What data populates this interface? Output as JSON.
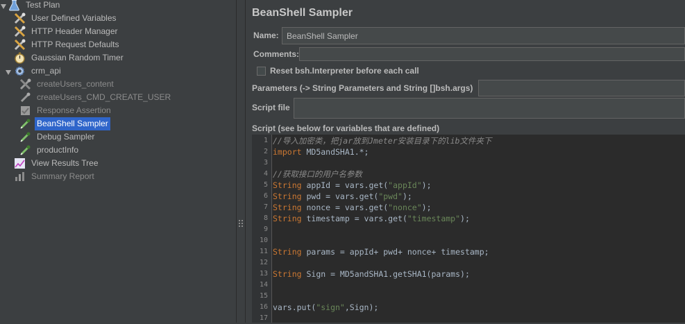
{
  "tree": {
    "items": [
      {
        "label": "Test Plan",
        "icon": "flask-icon"
      },
      {
        "label": "User Defined Variables",
        "icon": "wrench-screwdriver-icon"
      },
      {
        "label": "HTTP Header Manager",
        "icon": "wrench-screwdriver-icon"
      },
      {
        "label": "HTTP Request Defaults",
        "icon": "wrench-screwdriver-icon"
      },
      {
        "label": "Gaussian Random Timer",
        "icon": "stopwatch-icon"
      },
      {
        "label": "crm_api",
        "icon": "gear-icon"
      },
      {
        "label": "createUsers_content",
        "icon": "wrench-screwdriver-icon"
      },
      {
        "label": "createUsers_CMD_CREATE_USER",
        "icon": "pipette-icon"
      },
      {
        "label": "Response Assertion",
        "icon": "assertion-icon"
      },
      {
        "label": "BeanShell Sampler",
        "icon": "pipette-icon"
      },
      {
        "label": "Debug Sampler",
        "icon": "pipette-icon"
      },
      {
        "label": "productInfo",
        "icon": "pipette-icon"
      },
      {
        "label": "View Results Tree",
        "icon": "chart-icon"
      },
      {
        "label": "Summary Report",
        "icon": "bar-chart-icon"
      }
    ]
  },
  "panel": {
    "title": "BeanShell Sampler",
    "name_label": "Name:",
    "name_value": "BeanShell Sampler",
    "comments_label": "Comments:",
    "reset_label": "Reset bsh.Interpreter before each call",
    "params_label": "Parameters (-> String Parameters and String []bsh.args)",
    "script_file_label": "Script file",
    "script_label": "Script (see below for variables that are defined)"
  },
  "editor": {
    "line_numbers": [
      "1",
      "2",
      "3",
      "4",
      "5",
      "6",
      "7",
      "8",
      "9",
      "10",
      "11",
      "12",
      "13",
      "14",
      "15",
      "16",
      "17"
    ],
    "lines": [
      [
        {
          "t": "//导入加密类，把jar放到Jmeter安装目录下的lib文件夹下",
          "c": "cm"
        }
      ],
      [
        {
          "t": "import",
          "c": "kw"
        },
        {
          "t": " MD5andSHA1.*;",
          "c": ""
        }
      ],
      [],
      [
        {
          "t": "//获取接口的用户名参数",
          "c": "cm"
        }
      ],
      [
        {
          "t": "String",
          "c": "kw"
        },
        {
          "t": " appId = vars.get(",
          "c": ""
        },
        {
          "t": "\"appId\"",
          "c": "st"
        },
        {
          "t": ");",
          "c": ""
        }
      ],
      [
        {
          "t": "String",
          "c": "kw"
        },
        {
          "t": " pwd = vars.get(",
          "c": ""
        },
        {
          "t": "\"pwd\"",
          "c": "st"
        },
        {
          "t": ");",
          "c": ""
        }
      ],
      [
        {
          "t": "String",
          "c": "kw"
        },
        {
          "t": " nonce = vars.get(",
          "c": ""
        },
        {
          "t": "\"nonce\"",
          "c": "st"
        },
        {
          "t": ");",
          "c": ""
        }
      ],
      [
        {
          "t": "String",
          "c": "kw"
        },
        {
          "t": " timestamp = vars.get(",
          "c": ""
        },
        {
          "t": "\"timestamp\"",
          "c": "st"
        },
        {
          "t": ");",
          "c": ""
        }
      ],
      [],
      [],
      [
        {
          "t": "String",
          "c": "kw"
        },
        {
          "t": " params = appId+ pwd+ nonce+ timestamp;",
          "c": ""
        }
      ],
      [],
      [
        {
          "t": "String",
          "c": "kw"
        },
        {
          "t": " Sign = MD5andSHA1.getSHA1(params);",
          "c": ""
        }
      ],
      [],
      [],
      [
        {
          "t": "vars.put(",
          "c": ""
        },
        {
          "t": "\"sign\"",
          "c": "st"
        },
        {
          "t": ",Sign);",
          "c": ""
        }
      ],
      []
    ]
  },
  "colors": {
    "background": "#3c3f41",
    "selection": "#2f65ca",
    "keyword": "#cc7832",
    "string": "#6a8759",
    "comment": "#8a8a8a"
  }
}
